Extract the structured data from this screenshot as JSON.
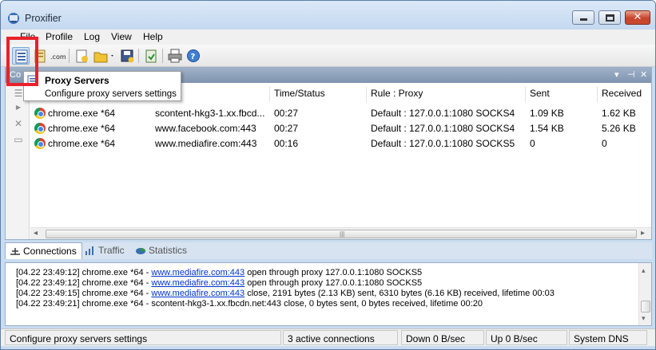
{
  "window": {
    "title": "Proxifier",
    "close_glyph": "✕"
  },
  "menu": {
    "items": [
      "File",
      "Profile",
      "Log",
      "View",
      "Help"
    ]
  },
  "toolbar": {
    "icons": [
      "proxy-servers-icon",
      "proxification-rules-icon",
      "name-resolution-icon",
      "new-profile-icon",
      "open-profile-icon",
      "save-profile-icon",
      "export-icon",
      "print-icon",
      "help-icon"
    ]
  },
  "connections_panel": {
    "title": "Co",
    "columns": [
      "Time/Status",
      "Rule : Proxy",
      "Sent",
      "Received"
    ],
    "rows": [
      {
        "app": "chrome.exe *64",
        "target": "scontent-hkg3-1.xx.fbcd...",
        "time": "00:27",
        "rule": "Default : 127.0.0.1:1080 SOCKS4",
        "sent": "1.09 KB",
        "received": "1.62 KB"
      },
      {
        "app": "chrome.exe *64",
        "target": "www.facebook.com:443",
        "time": "00:27",
        "rule": "Default : 127.0.0.1:1080 SOCKS4",
        "sent": "1.54 KB",
        "received": "5.26 KB"
      },
      {
        "app": "chrome.exe *64",
        "target": "www.mediafire.com:443",
        "time": "00:16",
        "rule": "Default : 127.0.0.1:1080 SOCKS5",
        "sent": "0",
        "received": "0"
      }
    ]
  },
  "tabs": {
    "items": [
      "Connections",
      "Traffic",
      "Statistics"
    ],
    "active": "Connections"
  },
  "log": {
    "lines": [
      {
        "prefix": "[04.22 23:49:12] chrome.exe *64 - ",
        "link": "www.mediafire.com:443",
        "suffix": " open through proxy 127.0.0.1:1080 SOCKS5"
      },
      {
        "prefix": "[04.22 23:49:12] chrome.exe *64 - ",
        "link": "www.mediafire.com:443",
        "suffix": " open through proxy 127.0.0.1:1080 SOCKS5"
      },
      {
        "prefix": "[04.22 23:49:15] chrome.exe *64 - ",
        "link": "www.mediafire.com:443",
        "suffix": " close, 2191 bytes (2.13 KB) sent, 6310 bytes (6.16 KB) received, lifetime 00:03"
      },
      {
        "prefix": "[04.22 23:49:21] chrome.exe *64 - scontent-hkg3-1.xx.fbcdn.net:443 close, 0 bytes sent, 0 bytes received, lifetime 00:20",
        "link": "",
        "suffix": ""
      }
    ]
  },
  "statusbar": {
    "message": "Configure proxy servers settings",
    "connections": "3 active connections",
    "down": "Down 0 B/sec",
    "up": "Up 0 B/sec",
    "dns": "System DNS"
  },
  "popup": {
    "title": "Proxy Servers",
    "description": "Configure proxy servers settings"
  },
  "colors": {
    "highlight": "#e8212b",
    "link": "#0033cc",
    "panel_header": "#8a9eb9"
  }
}
